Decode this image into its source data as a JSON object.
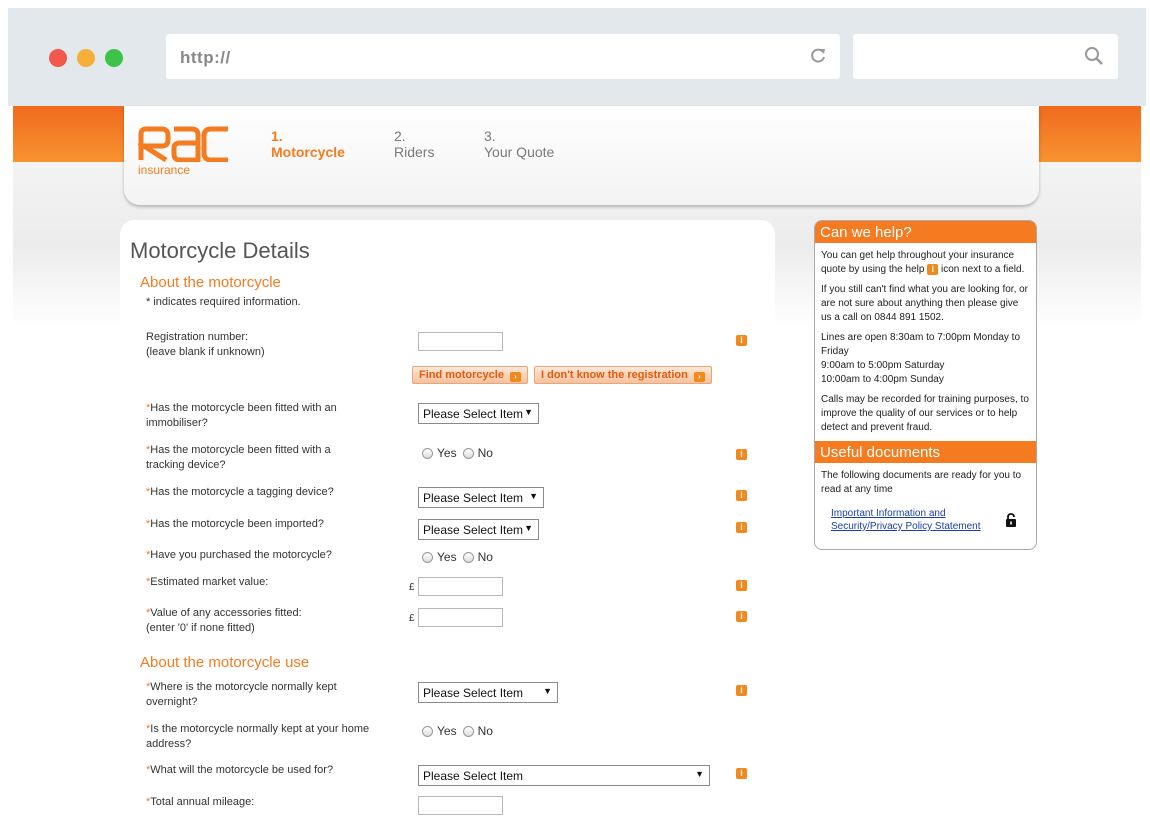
{
  "browser": {
    "url": "http://",
    "reload_icon": "reload-icon",
    "search_icon": "search-icon"
  },
  "header": {
    "logo_text": "RAC",
    "logo_sub": "insurance",
    "steps": [
      {
        "num": "1.",
        "label": "Motorcycle",
        "active": true
      },
      {
        "num": "2.",
        "label": "Riders",
        "active": false
      },
      {
        "num": "3.",
        "label": "Your Quote",
        "active": false
      }
    ]
  },
  "form": {
    "title": "Motorcycle Details",
    "section1": "About the motorcycle",
    "required_note": "* indicates required information.",
    "registration": {
      "label_line1": "Registration number:",
      "label_line2": "(leave blank if unknown)",
      "value": ""
    },
    "buttons": {
      "find": "Find motorcycle",
      "unknown": "I don't know the registration"
    },
    "immobiliser": {
      "label": "Has the motorcycle been fitted with an immobiliser?",
      "value": "Please Select Item"
    },
    "tracking": {
      "label": "Has the motorcycle been fitted with a tracking device?",
      "yes": "Yes",
      "no": "No"
    },
    "tagging": {
      "label": "Has the motorcycle a tagging device?",
      "value": "Please Select Item"
    },
    "imported": {
      "label": "Has the motorcycle been imported?",
      "value": "Please Select Item"
    },
    "purchased": {
      "label": "Have you purchased the motorcycle?",
      "yes": "Yes",
      "no": "No"
    },
    "market_value": {
      "label": "Estimated market value:",
      "currency": "£",
      "value": ""
    },
    "accessories": {
      "label_line1": "Value of any accessories fitted:",
      "label_line2": "(enter '0' if none fitted)",
      "currency": "£",
      "value": ""
    },
    "section2": "About the motorcycle use",
    "kept_overnight": {
      "label": "Where is the motorcycle normally kept overnight?",
      "value": "Please Select Item"
    },
    "kept_home": {
      "label": "Is the motorcycle normally kept at your home address?",
      "yes": "Yes",
      "no": "No"
    },
    "used_for": {
      "label": "What will the motorcycle be used for?",
      "value": "Please Select Item"
    },
    "mileage": {
      "label": "Total annual mileage:",
      "value": ""
    },
    "required_marker": "*",
    "info_glyph": "i"
  },
  "help": {
    "title": "Can we help?",
    "p1a": "You can get help throughout your insurance quote by using the help",
    "p1b": "icon next to a field.",
    "p2": "If you still can't find what you are looking for, or are not sure about anything then please give us a call on 0844 891 1502.",
    "p3a": "Lines are open 8:30am to 7:00pm Monday to Friday",
    "p3b": "9:00am to 5:00pm Saturday",
    "p3c": "10:00am to 4:00pm Sunday",
    "p4": "Calls may be recorded for training purposes, to improve the quality of our services or to help detect and prevent fraud.",
    "useful_title": "Useful documents",
    "useful_text": "The following documents are ready for you to read at any time",
    "doc_link": "Important Information and Security/Privacy Policy Statement",
    "lock_icon": "lock-icon"
  },
  "colors": {
    "accent": "#f47b20",
    "link": "#1a3fa6"
  }
}
